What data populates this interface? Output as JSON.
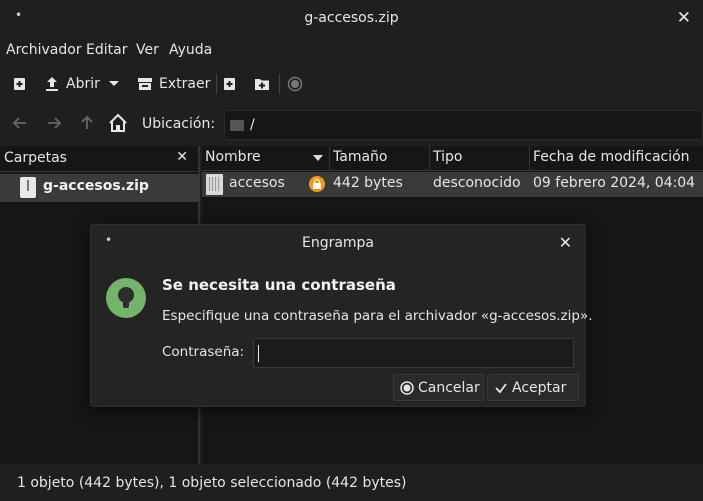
{
  "window": {
    "title": "g-accesos.zip"
  },
  "menu": [
    "Archivador",
    "Editar",
    "Ver",
    "Ayuda"
  ],
  "toolbar": {
    "open_label": "Abrir",
    "extract_label": "Extraer",
    "icons": [
      "new-archive-icon",
      "open-icon",
      "extract-icon",
      "add-files-icon",
      "add-folder-icon",
      "stop-icon"
    ]
  },
  "location": {
    "label": "Ubicación:",
    "path": "/"
  },
  "sidebar": {
    "title": "Carpetas",
    "items": [
      {
        "label": "g-accesos.zip"
      }
    ]
  },
  "filelist": {
    "columns": [
      "Nombre",
      "Tamaño",
      "Tipo",
      "Fecha de modificación"
    ],
    "rows": [
      {
        "name": "accesos",
        "size": "442 bytes",
        "type": "desconocido",
        "modified": "09 febrero 2024, 04:04",
        "encrypted": true
      }
    ]
  },
  "status": "1 objeto (442 bytes), 1 objeto seleccionado (442 bytes)",
  "dialog": {
    "title": "Engrampa",
    "heading": "Se necesita una contraseña",
    "description": "Especifique una contraseña para el archivador «g-accesos.zip».",
    "password_label": "Contraseña:",
    "password_value": "",
    "cancel_label": "Cancelar",
    "accept_label": "Aceptar"
  },
  "colors": {
    "selection": "#3a3a3a",
    "lock_badge": "#f09a1b",
    "dialog_icon": "#73b36b"
  }
}
